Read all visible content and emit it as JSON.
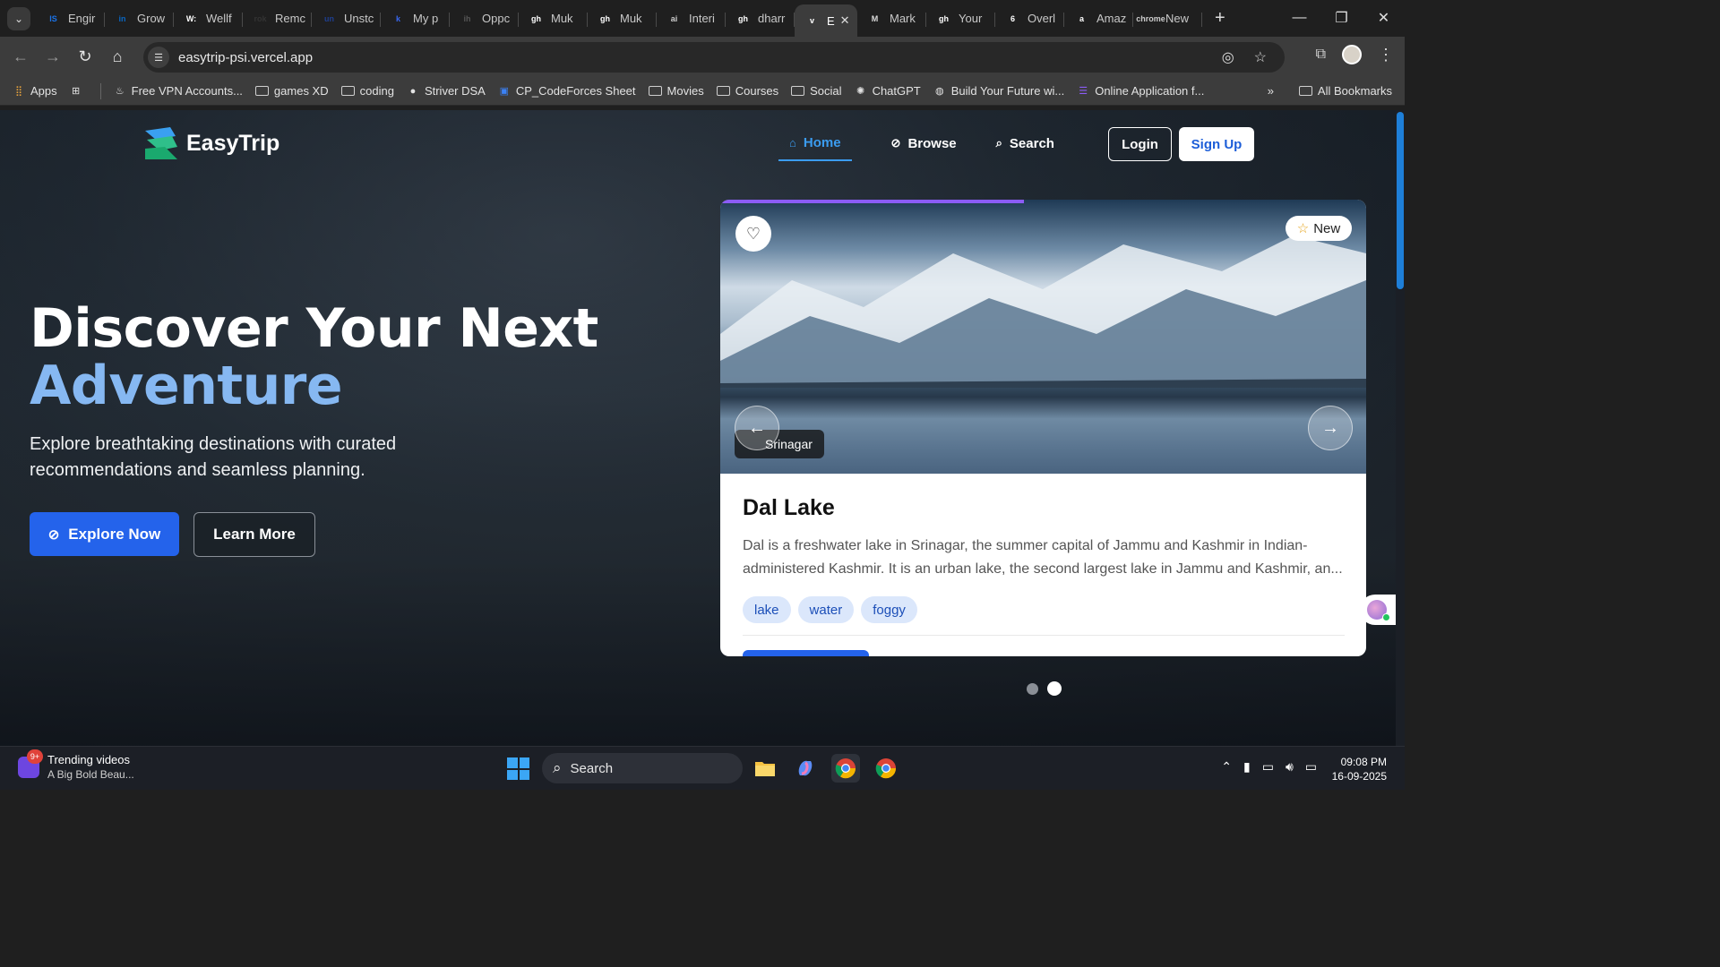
{
  "browser": {
    "tabs": [
      {
        "label": "Engir",
        "favicon": "IS",
        "color": "#1a73e8"
      },
      {
        "label": "Grow",
        "favicon": "in",
        "color": "#0a66c2"
      },
      {
        "label": "Wellf",
        "favicon": "W:",
        "color": "#ffffff"
      },
      {
        "label": "Remc",
        "favicon": "rok",
        "color": "#333333"
      },
      {
        "label": "Unstc",
        "favicon": "un",
        "color": "#1f3f8f"
      },
      {
        "label": "My p",
        "favicon": "k",
        "color": "#3867f0"
      },
      {
        "label": "Oppc",
        "favicon": "ih",
        "color": "#555555"
      },
      {
        "label": "Muk",
        "favicon": "gh",
        "color": "#ffffff"
      },
      {
        "label": "Muk",
        "favicon": "gh",
        "color": "#ffffff"
      },
      {
        "label": "Interi",
        "favicon": "ai",
        "color": "#cccccc"
      },
      {
        "label": "dharr",
        "favicon": "gh",
        "color": "#ffffff"
      },
      {
        "label": "E",
        "favicon": "v",
        "color": "#ffffff",
        "active": true
      },
      {
        "label": "Mark",
        "favicon": "M",
        "color": "#dddddd"
      },
      {
        "label": "Your",
        "favicon": "gh",
        "color": "#ffffff"
      },
      {
        "label": "Overl",
        "favicon": "6",
        "color": "#ffffff"
      },
      {
        "label": "Amaz",
        "favicon": "a",
        "color": "#ffffff"
      },
      {
        "label": "New",
        "favicon": "chrome",
        "color": "#cccccc"
      }
    ],
    "url": "easytrip-psi.vercel.app",
    "bookmarks": [
      {
        "label": "Apps",
        "type": "apps-icon"
      },
      {
        "label": "",
        "type": "grid-icon"
      },
      {
        "label": "Free VPN Accounts...",
        "type": "fire-icon"
      },
      {
        "label": "games XD",
        "type": "folder"
      },
      {
        "label": "coding",
        "type": "folder"
      },
      {
        "label": "Striver DSA",
        "type": "tuf-icon"
      },
      {
        "label": "CP_CodeForces Sheet",
        "type": "sheet-icon"
      },
      {
        "label": "Movies",
        "type": "folder"
      },
      {
        "label": "Courses",
        "type": "folder"
      },
      {
        "label": "Social",
        "type": "folder"
      },
      {
        "label": "ChatGPT",
        "type": "chatgpt-icon"
      },
      {
        "label": "Build Your Future wi...",
        "type": "globe-icon"
      },
      {
        "label": "Online Application f...",
        "type": "form-icon"
      }
    ],
    "all_bookmarks": "All Bookmarks"
  },
  "site": {
    "logo": "EasyTrip",
    "nav": {
      "home": "Home",
      "browse": "Browse",
      "search": "Search",
      "login": "Login",
      "signup": "Sign Up"
    },
    "hero": {
      "title_line1": "Discover Your Next",
      "title_line2": "Adventure",
      "subtitle": "Explore breathtaking destinations with curated recommendations and seamless planning.",
      "explore": "Explore Now",
      "learn": "Learn More"
    },
    "card": {
      "badge": "New",
      "location": "Srinagar",
      "title": "Dal Lake",
      "description": "Dal is a freshwater lake in Srinagar, the summer capital of Jammu and Kashmir in Indian-administered Kashmir. It is an urban lake, the second largest lake in Jammu and Kashmir, an...",
      "tags": [
        "lake",
        "water",
        "foggy"
      ],
      "progress": 0.47
    },
    "carousel": {
      "count": 2,
      "active": 2
    }
  },
  "taskbar": {
    "news_badge": "9+",
    "news_title": "Trending videos",
    "news_sub": "A Big Bold Beau...",
    "search": "Search",
    "time": "09:08 PM",
    "date": "16-09-2025"
  },
  "colors": {
    "accent": "#2463eb",
    "hero_accent": "#86b8f2",
    "nav_active": "#3b9cf0",
    "tag_bg": "#dbe7fb"
  }
}
